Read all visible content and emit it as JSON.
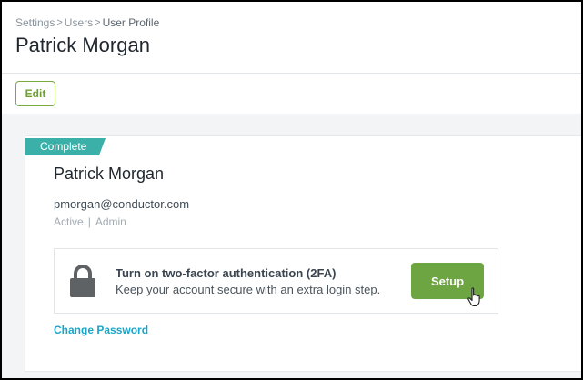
{
  "breadcrumb": {
    "items": [
      "Settings",
      "Users",
      "User Profile"
    ],
    "separator": ">"
  },
  "page": {
    "title": "Patrick Morgan"
  },
  "toolbar": {
    "edit_label": "Edit"
  },
  "profile": {
    "status_badge": "Complete",
    "name": "Patrick Morgan",
    "email": "pmorgan@conductor.com",
    "state": "Active",
    "meta_separator": "|",
    "role": "Admin"
  },
  "two_factor": {
    "icon": "lock-icon",
    "title": "Turn on two-factor authentication (2FA)",
    "description": "Keep your account secure with an extra login step.",
    "setup_label": "Setup"
  },
  "links": {
    "change_password": "Change Password"
  },
  "colors": {
    "accent_green": "#6ca541",
    "status_teal": "#3ab0a8",
    "link_blue": "#1aa6c9"
  }
}
